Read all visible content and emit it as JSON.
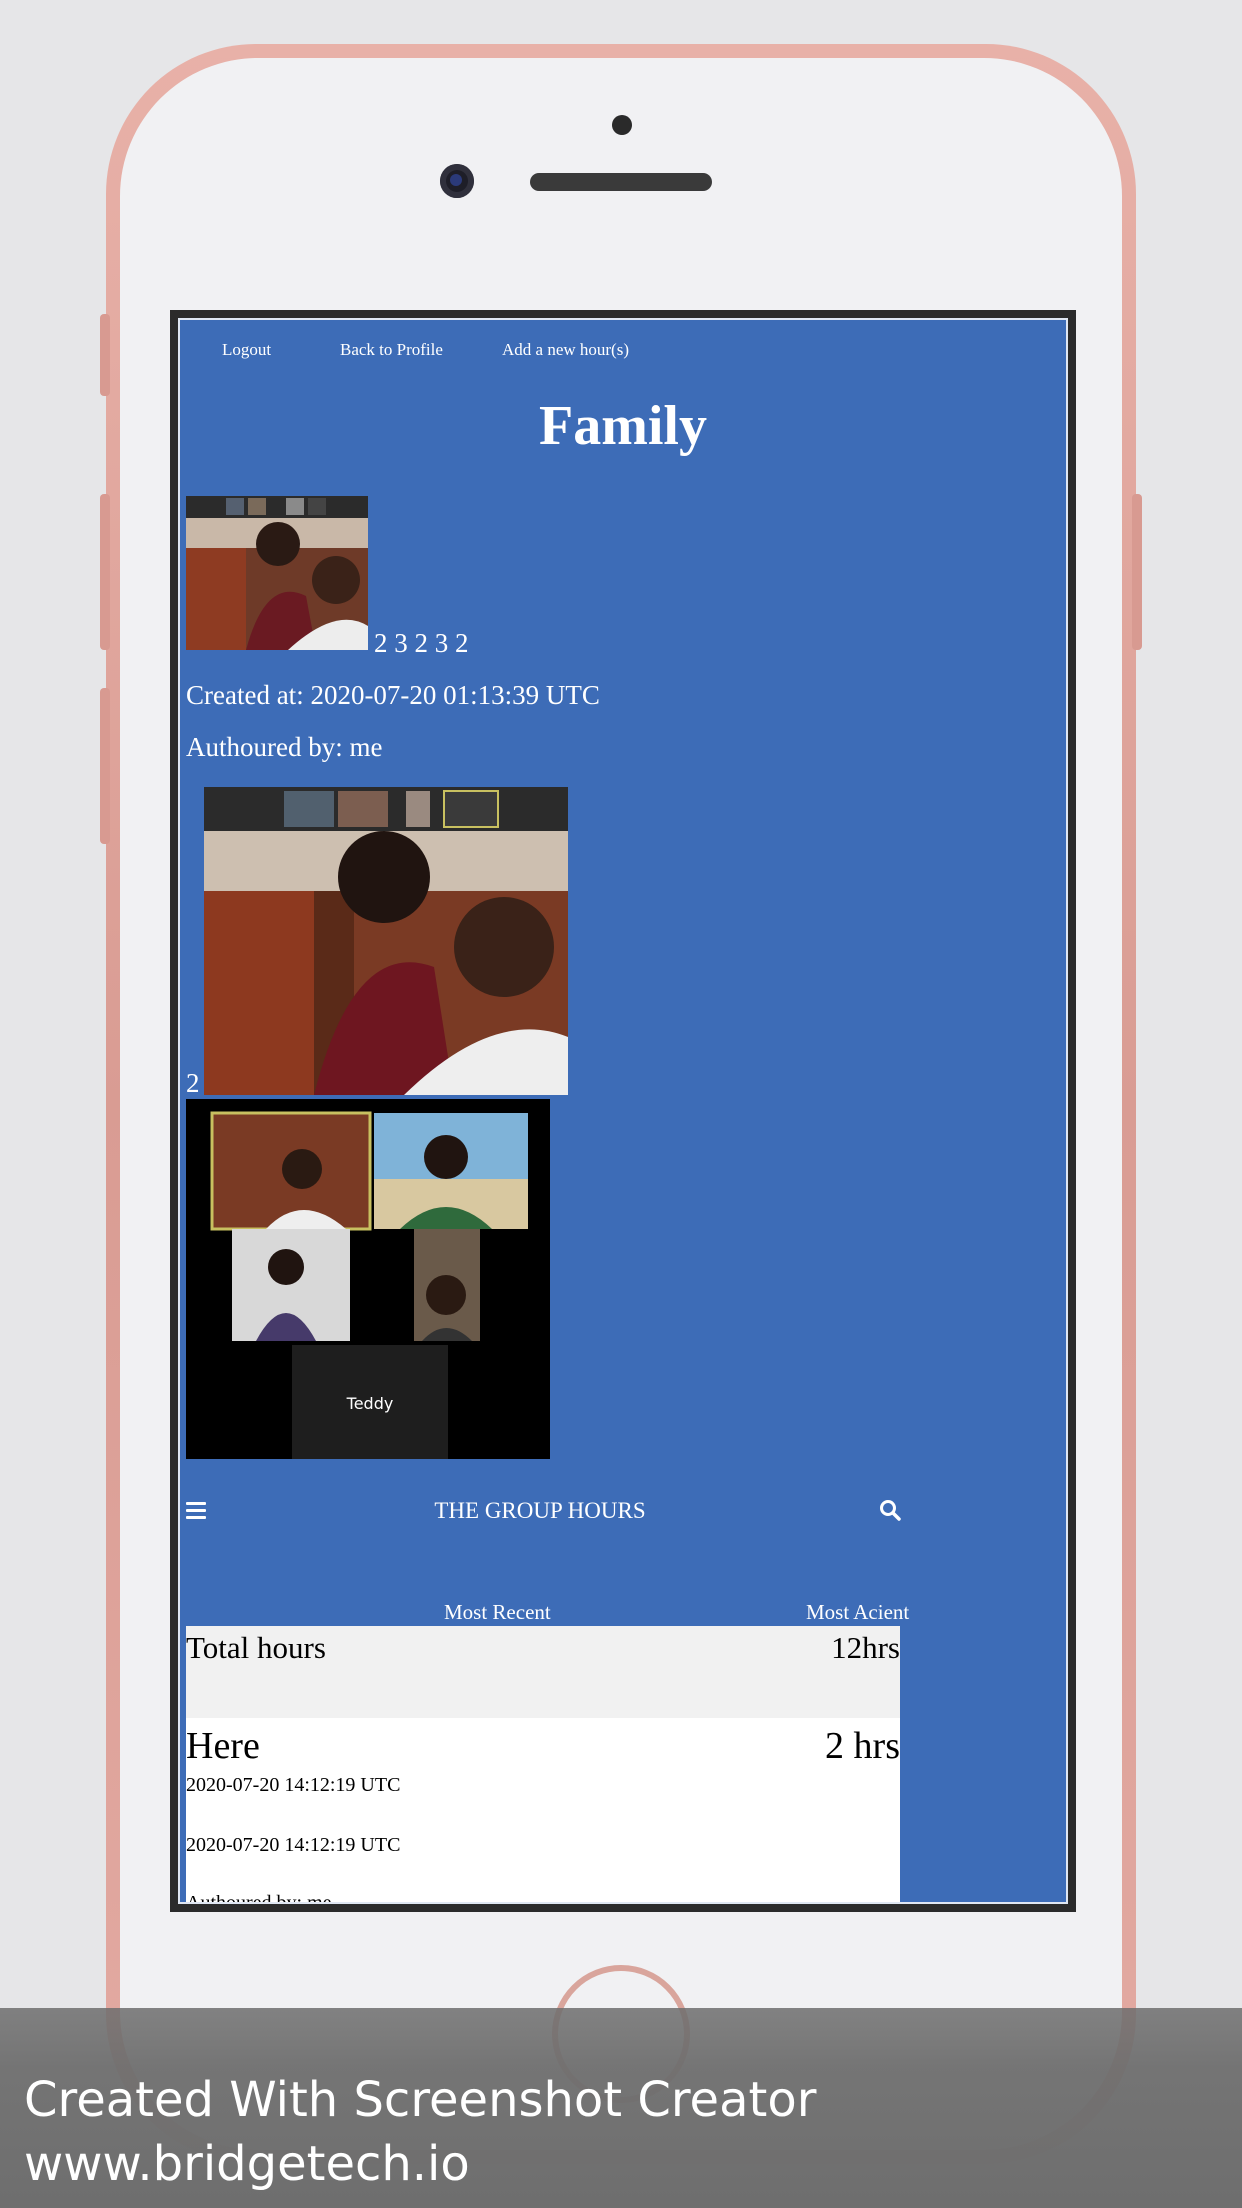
{
  "nav": {
    "logout": "Logout",
    "back_to_profile": "Back to Profile",
    "add_hours": "Add a new hour(s)"
  },
  "page": {
    "title": "Family",
    "thumb_digits": "2 3 2 3 2",
    "created_at": "Created at: 2020-07-20 01:13:39 UTC",
    "authored_by": "Authoured by: me",
    "photo_number": "2",
    "grid_label": "Teddy"
  },
  "group_bar": {
    "title": "THE GROUP HOURS"
  },
  "sort": {
    "most_recent": "Most Recent",
    "most_ancient": "Most Acient"
  },
  "totals": {
    "label": "Total hours",
    "value": "12hrs"
  },
  "hours": [
    {
      "title": "Here",
      "value": "2 hrs",
      "date1": "2020-07-20 14:12:19 UTC",
      "date2": "2020-07-20 14:12:19 UTC",
      "author": "Authoured by: me"
    }
  ],
  "watermark": {
    "line1": "Created With Screenshot Creator",
    "line2": "www.bridgetech.io"
  },
  "colors": {
    "screen_bg": "#3d6cb7",
    "phone_frame": "#e3aaa2",
    "watermark_bg": "#6e6e6e"
  },
  "icons": [
    "menu-icon",
    "search-icon"
  ]
}
